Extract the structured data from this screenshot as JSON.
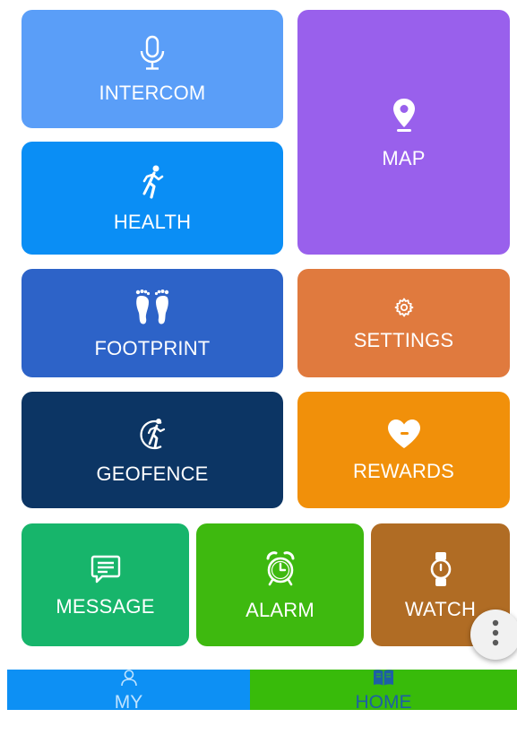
{
  "tiles": {
    "intercom": {
      "label": "INTERCOM",
      "icon": "microphone-icon",
      "color": "#5a9ef8"
    },
    "health": {
      "label": "HEALTH",
      "icon": "runner-icon",
      "color": "#0a8ef5"
    },
    "map": {
      "label": "MAP",
      "icon": "map-pin-icon",
      "color": "#9960ec"
    },
    "footprint": {
      "label": "FOOTPRINT",
      "icon": "footprints-icon",
      "color": "#2d63c8"
    },
    "settings": {
      "label": "SETTINGS",
      "icon": "gear-icon",
      "color": "#e07a3e"
    },
    "geofence": {
      "label": "GEOFENCE",
      "icon": "geofence-runner-icon",
      "color": "#0c3564"
    },
    "rewards": {
      "label": "REWARDS",
      "icon": "heart-icon",
      "color": "#f1900a"
    },
    "message": {
      "label": "MESSAGE",
      "icon": "chat-bubble-icon",
      "color": "#17b56b"
    },
    "alarm": {
      "label": "ALARM",
      "icon": "alarm-clock-icon",
      "color": "#3eb90f"
    },
    "watch": {
      "label": "WATCH",
      "icon": "watch-icon",
      "color": "#b06c24"
    }
  },
  "fab": {
    "icon": "more-vertical-icon"
  },
  "bottom_nav": {
    "my": {
      "label": "MY",
      "icon": "person-icon",
      "color": "#0d90f4"
    },
    "home": {
      "label": "HOME",
      "icon": "book-icon",
      "color": "#38bb0a",
      "active": true
    }
  }
}
